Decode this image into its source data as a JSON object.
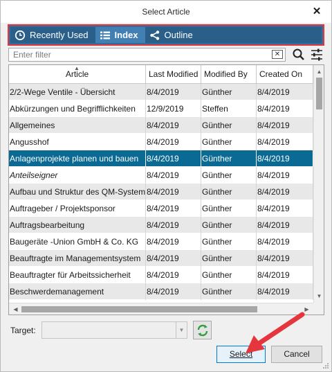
{
  "window": {
    "title": "Select Article",
    "close_glyph": "✕"
  },
  "tabs": [
    {
      "label": "Recently Used",
      "icon": "clock-icon",
      "active": false
    },
    {
      "label": "Index",
      "icon": "list-icon",
      "active": true
    },
    {
      "label": "Outline",
      "icon": "share-icon",
      "active": false
    }
  ],
  "filter": {
    "placeholder": "Enter filter",
    "value": "",
    "clear_glyph": "✕"
  },
  "table": {
    "columns": [
      "Article",
      "Last Modified",
      "Modified By",
      "Created On"
    ],
    "selected_index": 4,
    "rows": [
      {
        "article": "2/2-Wege Ventile - Übersicht",
        "modified": "8/4/2019",
        "by": "Günther",
        "created": "8/4/2019"
      },
      {
        "article": "Abkürzungen und Begrifflichkeiten",
        "modified": "12/9/2019",
        "by": "Steffen",
        "created": "8/4/2019"
      },
      {
        "article": "Allgemeines",
        "modified": "8/4/2019",
        "by": "Günther",
        "created": "8/4/2019"
      },
      {
        "article": "Angusshof",
        "modified": "8/4/2019",
        "by": "Günther",
        "created": "8/4/2019"
      },
      {
        "article": "Anlagenprojekte planen und bauen",
        "modified": "8/4/2019",
        "by": "Günther",
        "created": "8/4/2019"
      },
      {
        "article": "Anteilseigner",
        "modified": "8/4/2019",
        "by": "Günther",
        "created": "8/4/2019",
        "italic": true
      },
      {
        "article": "Aufbau und Struktur des QM-Systems",
        "modified": "8/4/2019",
        "by": "Günther",
        "created": "8/4/2019"
      },
      {
        "article": "Auftrageber / Projektsponsor",
        "modified": "8/4/2019",
        "by": "Günther",
        "created": "8/4/2019"
      },
      {
        "article": "Auftragsbearbeitung",
        "modified": "8/4/2019",
        "by": "Günther",
        "created": "8/4/2019"
      },
      {
        "article": "Baugeräte -Union GmbH & Co. KG",
        "modified": "8/4/2019",
        "by": "Günther",
        "created": "8/4/2019"
      },
      {
        "article": "Beauftragte im Managementsystem",
        "modified": "8/4/2019",
        "by": "Günther",
        "created": "8/4/2019"
      },
      {
        "article": "Beauftragter für Arbeitssicherheit",
        "modified": "8/4/2019",
        "by": "Günther",
        "created": "8/4/2019"
      },
      {
        "article": "Beschwerdemanagement",
        "modified": "8/4/2019",
        "by": "Günther",
        "created": "8/4/2019"
      }
    ]
  },
  "target": {
    "label": "Target:",
    "value": ""
  },
  "buttons": {
    "select": "Select",
    "cancel": "Cancel"
  },
  "colors": {
    "tabbar": "#2a5f89",
    "active_tab": "#4280b3",
    "highlight_border": "#e5363d",
    "selected_row": "#0b6a93",
    "annotation_arrow": "#e5363d"
  }
}
